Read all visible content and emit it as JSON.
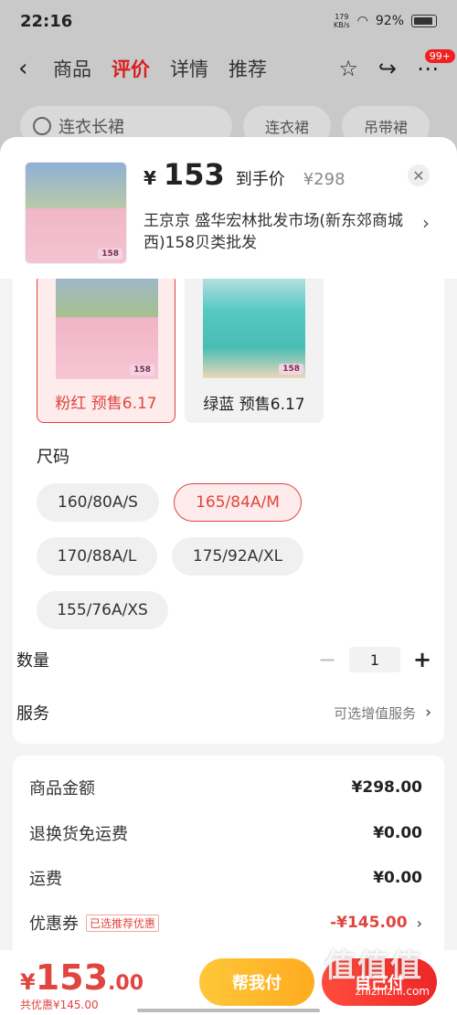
{
  "status": {
    "time": "22:16",
    "speed_top": "179",
    "speed_bottom": "KB/s",
    "battery": "92%"
  },
  "nav": {
    "back": "‹",
    "tabs": [
      "商品",
      "评价",
      "详情",
      "推荐"
    ],
    "active_tab": "评价",
    "badge": "99+"
  },
  "search": {
    "placeholder": "连衣长裙",
    "chips": [
      "连衣裙",
      "吊带裙"
    ]
  },
  "product": {
    "price_symbol": "¥",
    "price": "153",
    "price_label": "到手价",
    "original_price": "¥298",
    "shop": "王京京  盛华宏林批发市场(新东郊商城西)158贝类批发",
    "thumb_tag": "158"
  },
  "colors": [
    {
      "label": "粉红  预售6.17",
      "selected": true,
      "tag": "158"
    },
    {
      "label": "绿蓝  预售6.17",
      "selected": false,
      "tag": "158"
    }
  ],
  "size": {
    "title": "尺码",
    "options": [
      "160/80A/S",
      "165/84A/M",
      "170/88A/L",
      "175/92A/XL",
      "155/76A/XS"
    ],
    "selected": "165/84A/M"
  },
  "quantity": {
    "label": "数量",
    "minus": "−",
    "value": "1",
    "plus": "+"
  },
  "service": {
    "label": "服务",
    "hint": "可选增值服务",
    "arrow": "›"
  },
  "summary": {
    "items": [
      {
        "label": "商品金额",
        "value": "¥298.00"
      },
      {
        "label": "退换货免运费",
        "value": "¥0.00"
      },
      {
        "label": "运费",
        "value": "¥0.00"
      }
    ],
    "coupon": {
      "label": "优惠券",
      "badge": "已选推荐优惠",
      "value": "-¥145.00"
    }
  },
  "bottom": {
    "total_symbol": "¥",
    "total_int": "153",
    "total_dec": ".00",
    "discount": "共优惠¥145.00",
    "pay_friend": "帮我付",
    "pay_self": "自己付"
  },
  "watermark": {
    "big": "值值值",
    "small": "zhizhizhi.com"
  },
  "colors_theme": {
    "accent": "#e0453f",
    "pay_friend": "#ffb526",
    "pay_self": "#ee2727"
  }
}
